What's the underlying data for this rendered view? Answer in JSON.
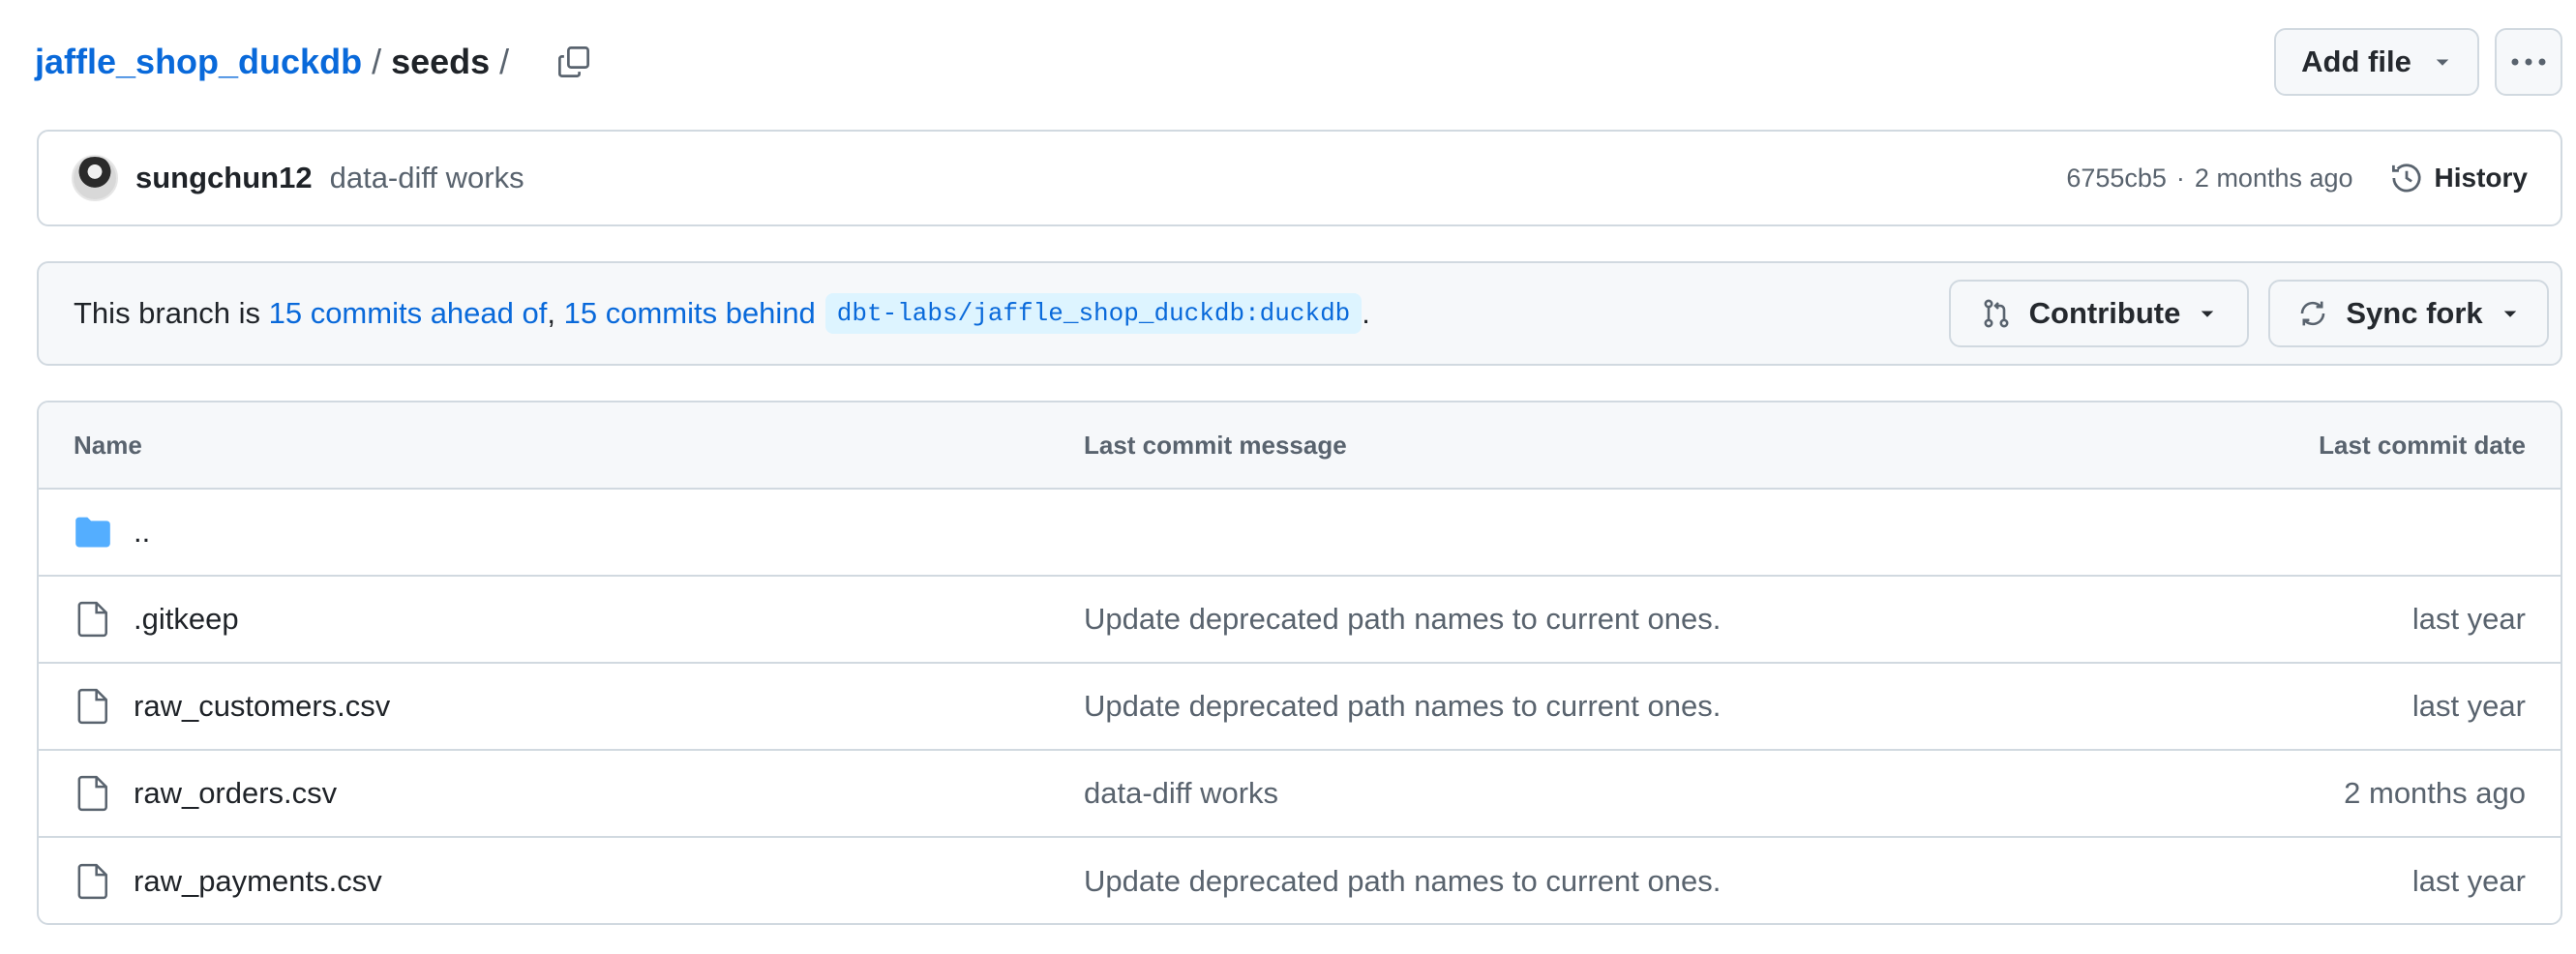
{
  "breadcrumb": {
    "repo": "jaffle_shop_duckdb",
    "separator": "/",
    "dir": "seeds",
    "trailing": "/"
  },
  "toolbar": {
    "add_file_label": "Add file",
    "more_label": "···"
  },
  "commit": {
    "author": "sungchun12",
    "message": "data-diff works",
    "sha": "6755cb5",
    "dot": "·",
    "time": "2 months ago",
    "history_label": "History"
  },
  "branch": {
    "prefix": "This branch is",
    "ahead": "15 commits ahead of",
    "comma": ",",
    "behind": "15 commits behind",
    "upstream": "dbt-labs/jaffle_shop_duckdb:duckdb",
    "period": ".",
    "contribute_label": "Contribute",
    "sync_label": "Sync fork"
  },
  "table": {
    "headers": {
      "name": "Name",
      "message": "Last commit message",
      "date": "Last commit date"
    },
    "parent": "..",
    "rows": [
      {
        "name": ".gitkeep",
        "message": "Update deprecated path names to current ones.",
        "date": "last year"
      },
      {
        "name": "raw_customers.csv",
        "message": "Update deprecated path names to current ones.",
        "date": "last year"
      },
      {
        "name": "raw_orders.csv",
        "message": "data-diff works",
        "date": "2 months ago"
      },
      {
        "name": "raw_payments.csv",
        "message": "Update deprecated path names to current ones.",
        "date": "last year"
      }
    ]
  },
  "colors": {
    "link": "#0969da",
    "muted": "#59636e",
    "border": "#d1d9e0",
    "folder": "#54aeff"
  }
}
